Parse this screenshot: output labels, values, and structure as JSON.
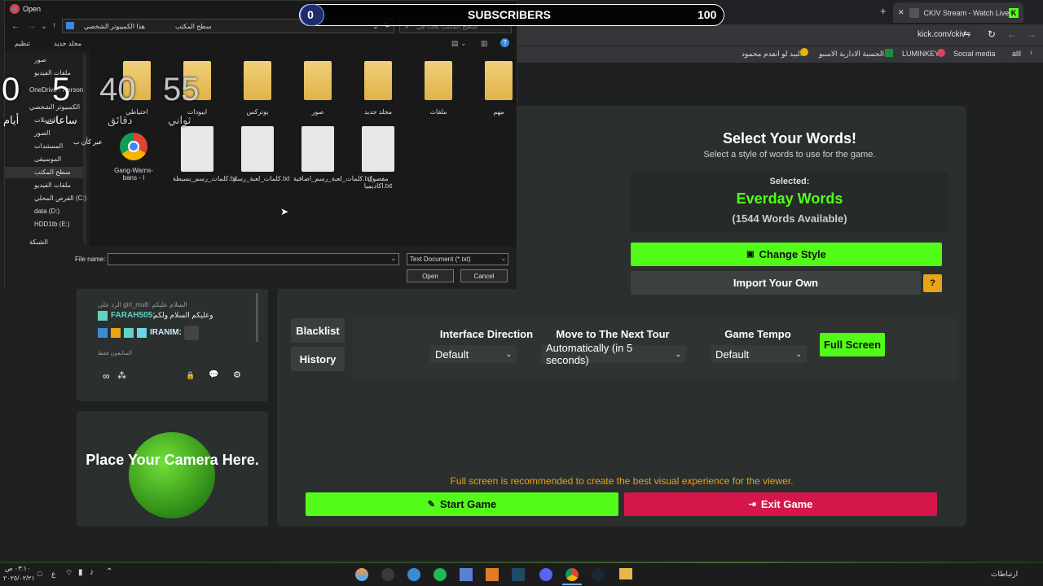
{
  "overlay": {
    "count": "0",
    "label": "SUBSCRIBERS",
    "target": "100"
  },
  "countdown": {
    "days_value": "0",
    "days_label": "أيام",
    "hours_value": "5",
    "hours_label": "ساعات",
    "minutes_value": "40",
    "minutes_label": "دقائق",
    "seconds_value": "55",
    "seconds_label": "ثواني",
    "note": "عبر كأن ب"
  },
  "browser": {
    "tab_title": "CKIV Stream - Watch Live o",
    "url": "kick.com/ckiv",
    "bookmarks": [
      "alll",
      "Social media",
      "LUMINKEY",
      "الحسبة الادارية الاسبو...",
      "البيد لو انعدم محمود"
    ]
  },
  "dialog": {
    "title": "Open",
    "breadcrumb": [
      "هذا الكمبيوتر الشخصي",
      "سطح المكتب"
    ],
    "search_placeholder": "سطح المكتب بحث في",
    "organize": "تنظيم",
    "new_folder": "مجلد جديد",
    "nav_items": [
      "صور",
      "ملفات الفيديو",
      "OneDrive - Person",
      "الكمبيوتر الشخصي",
      "التنزيلات",
      "الصور",
      "المستندات",
      "الموسيقى",
      "سطح المكتب",
      "ملفات الفيديو",
      "القرص المحلي (C:)",
      "data (D:)",
      "HDD1tb (E:)",
      "الشبكة"
    ],
    "folders": [
      "مهم",
      "ملفات",
      "مجلد جديد",
      "صور",
      "بوترکس",
      "ايبودات",
      "احتياطي"
    ],
    "files": [
      "مفصول اكاديميا.txt",
      "كلمات_لعبة_رسم_اضافية.txt",
      "كلمات_لعبة_رسم.txt",
      "كلمات_رسم_بسيطة.txt",
      "Gang-Warns-bans - ا"
    ],
    "file_name_label": "File name:",
    "file_name_value": "",
    "file_type": "Text Document (*.txt)",
    "open": "Open",
    "cancel": "Cancel"
  },
  "game": {
    "title": "Select Your Words!",
    "subtitle": "Select a style of words to use for the game.",
    "selected_label": "Selected:",
    "selected_value": "Everday Words",
    "available": "(1544 Words Available)",
    "change_style": "Change Style",
    "import_own": "Import Your Own",
    "help": "?",
    "blacklist": "Blacklist",
    "history": "History",
    "interface_direction_label": "Interface Direction",
    "interface_direction_value": "Default",
    "move_next_label": "Move to The Next Tour",
    "move_next_value": "Automatically (in 5 seconds)",
    "tempo_label": "Game Tempo",
    "tempo_value": "Default",
    "full_screen": "Full Screen",
    "recommend": "Full screen is recommended to create the best visual experience for the viewer.",
    "start": "Start Game",
    "exit": "Exit Game"
  },
  "chat": {
    "reply_note": "الرد على girl_mu8: السلام عليكم",
    "msg1_user": "FARAH505:",
    "msg1_text": "وعليكم السلام ولكم",
    "msg2_user": "IRANIM:",
    "mods_label": "المتابعون فقط"
  },
  "camera": {
    "placeholder": "Place Your Camera Here."
  },
  "taskbar": {
    "time": "٠٣:١٠ ص",
    "date": "٢٠٢٥/٠٢/٢١",
    "lang": "ع",
    "links": "ارتباطات"
  },
  "colors": {
    "accent": "#53fc18",
    "danger": "#d4164b",
    "warning": "#e8a317",
    "panel": "#2b2f2e"
  }
}
